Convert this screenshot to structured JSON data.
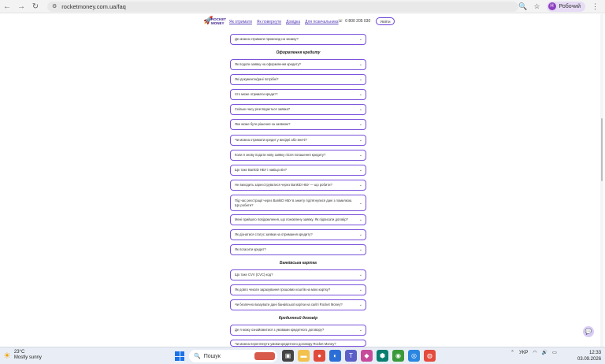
{
  "browser": {
    "url": "rocketmoney.com.ua/faq",
    "profile_initial": "Н",
    "profile_name": "Робочий"
  },
  "header": {
    "logo_line1": "ROCKET",
    "logo_line2": "MONEY",
    "nav": [
      "Як отримати",
      "Як повернути",
      "Довідка",
      "Для позичальника"
    ],
    "phone": "0 800 205 030",
    "login": "Увійти"
  },
  "faq": {
    "top_item": "Де можна отримати промокод на знижку?",
    "sections": [
      {
        "title": "Оформлення кредиту",
        "items": [
          "Як подати заявку на оформлення кредиту?",
          "Які документи/дані потрібні?",
          "Хто може отримати кредит?",
          "Скільки часу розглядається заявка?",
          "Яке може бути рішення за заявкою?",
          "Чи можна отримати кредит у вихідні або вночі?",
          "Коли я знову подати нову заявку після погашення кредиту?",
          "Що таке BankID НБУ і навіщо він?",
          "Не виходить зареєструватися через BankID НБУ — що робити?",
          "Під час реєстрації через BankID НБУ в анкету підтягнулися дані з помилкою. Що робити?",
          "Мені прийшло повідомлення, що поновлену заявку. Як підписати договір?",
          "Як дізнатися статус заявки на отримання кредиту?",
          "Як погасити кредит?"
        ]
      },
      {
        "title": "Банківська картка",
        "items": [
          "Що таке CVV (CVC) код?",
          "Як довго чекати зарахування грошових коштів на мою картку?",
          "Чи безпечно вказувати дані банківської картки на сайті Rocket Money?"
        ]
      },
      {
        "title": "Кредитний договір",
        "items": [
          "Де я можу ознайомитися з умовами кредитного договору?",
          "Чи можна переглянути умови кредитного договору Rocket Money?"
        ]
      }
    ]
  },
  "taskbar": {
    "temp": "23°C",
    "weather": "Mostly sunny",
    "search_placeholder": "Пошук",
    "lang": "УКР",
    "time": "12:33",
    "date": "03.09.2026"
  },
  "colors": {
    "accent": "#7a52dc",
    "brand_dark": "#3b1a8a",
    "profile_bg": "#e6dcf5"
  }
}
